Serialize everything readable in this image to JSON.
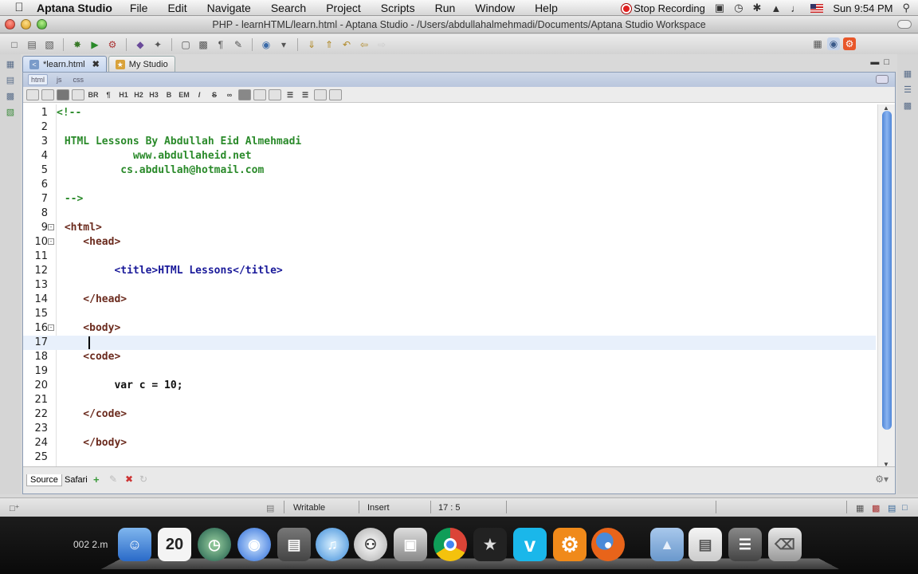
{
  "menubar": {
    "app_name": "Aptana Studio",
    "items": [
      "File",
      "Edit",
      "Navigate",
      "Search",
      "Project",
      "Scripts",
      "Run",
      "Window",
      "Help"
    ],
    "recording_label": "Stop Recording",
    "clock": "Sun 9:54 PM"
  },
  "window": {
    "title": "PHP - learnHTML/learn.html - Aptana Studio - /Users/abdullahalmehmadi/Documents/Aptana Studio Workspace"
  },
  "editor": {
    "tabs": [
      {
        "label": "*learn.html"
      },
      {
        "label": "My Studio"
      }
    ],
    "lang_tabs": [
      "html",
      "js",
      "css"
    ],
    "format_buttons": [
      "BR",
      "¶",
      "H1",
      "H2",
      "H3",
      "B",
      "EM",
      "I",
      "S"
    ],
    "lines": [
      {
        "num": "1",
        "text": "<!--"
      },
      {
        "num": "2",
        "text": ""
      },
      {
        "num": "3",
        "text": " HTML Lessons By Abdullah Eid Almehmadi"
      },
      {
        "num": "4",
        "text": "            www.abdullaheid.net"
      },
      {
        "num": "5",
        "text": "          cs.abdullah@hotmail.com"
      },
      {
        "num": "6",
        "text": ""
      },
      {
        "num": "7",
        "text": " -->"
      },
      {
        "num": "8",
        "text": ""
      },
      {
        "num": "9",
        "text": " <html>"
      },
      {
        "num": "10",
        "text": "    <head>"
      },
      {
        "num": "11",
        "text": ""
      },
      {
        "num": "12",
        "text": "         <title>HTML Lessons</title>"
      },
      {
        "num": "13",
        "text": ""
      },
      {
        "num": "14",
        "text": "    </head>"
      },
      {
        "num": "15",
        "text": ""
      },
      {
        "num": "16",
        "text": "    <body>"
      },
      {
        "num": "17",
        "text": ""
      },
      {
        "num": "18",
        "text": "    <code>"
      },
      {
        "num": "19",
        "text": ""
      },
      {
        "num": "20",
        "text": "         var c = 10;"
      },
      {
        "num": "21",
        "text": ""
      },
      {
        "num": "22",
        "text": "    </code>"
      },
      {
        "num": "23",
        "text": ""
      },
      {
        "num": "24",
        "text": "    </body>"
      },
      {
        "num": "25",
        "text": ""
      }
    ],
    "footer_tabs": [
      "Source",
      "Safari"
    ]
  },
  "status": {
    "writable": "Writable",
    "insert_mode": "Insert",
    "position": "17 : 5"
  },
  "dock": {
    "label": "002 2.m",
    "calendar_day": "20",
    "icons": [
      "finder-icon",
      "calendar-icon",
      "time-machine-icon",
      "browser-icon",
      "notes-icon",
      "itunes-icon",
      "mac-icon",
      "preview-icon",
      "chrome-icon",
      "imovie-icon",
      "vimeo-icon",
      "settings-icon",
      "firefox-icon",
      "applications-folder-icon",
      "mamp-icon",
      "server-icon",
      "trash-icon"
    ]
  }
}
